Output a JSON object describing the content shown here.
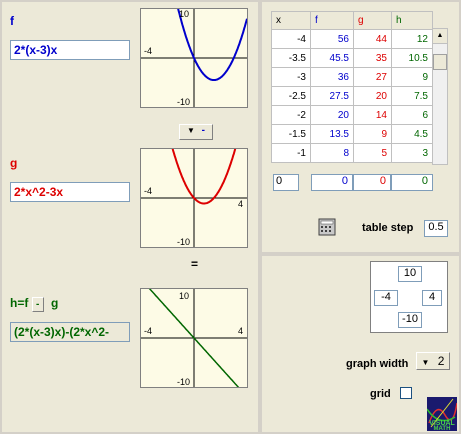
{
  "f": {
    "label": "f",
    "expr": "2*(x-3)x",
    "color": "#0000cc",
    "graph": {
      "ymax": "10",
      "xmin": "-4",
      "ymin": "-10"
    }
  },
  "op": {
    "symbol": "-"
  },
  "g": {
    "label": "g",
    "expr": "2*x^2-3x",
    "color": "#dd0000",
    "graph": {
      "xmin": "-4",
      "xmax": "4",
      "ymin": "-10"
    }
  },
  "equals": "=",
  "h": {
    "label_prefix": "h=f",
    "op": "-",
    "label_suffix": "g",
    "expr": "(2*(x-3)x)-(2*x^2-",
    "color": "#006600",
    "graph": {
      "ymax": "10",
      "xmin": "-4",
      "xmax": "4",
      "ymin": "-10"
    }
  },
  "table": {
    "headers": [
      "x",
      "f",
      "g",
      "h"
    ],
    "rows": [
      [
        "-4",
        "56",
        "44",
        "12"
      ],
      [
        "-3.5",
        "45.5",
        "35",
        "10.5"
      ],
      [
        "-3",
        "36",
        "27",
        "9"
      ],
      [
        "-2.5",
        "27.5",
        "20",
        "7.5"
      ],
      [
        "-2",
        "20",
        "14",
        "6"
      ],
      [
        "-1.5",
        "13.5",
        "9",
        "4.5"
      ],
      [
        "-1",
        "8",
        "5",
        "3"
      ]
    ],
    "input_row": [
      "0",
      "0",
      "0",
      "0"
    ]
  },
  "table_step": {
    "label": "table step",
    "value": "0.5"
  },
  "window": {
    "ymax": "10",
    "xmin": "-4",
    "xmax": "4",
    "ymin": "-10"
  },
  "graph_width": {
    "label": "graph width",
    "value": "2"
  },
  "grid": {
    "label": "grid",
    "checked": false
  },
  "logo": {
    "text": "VISUAL MATH"
  }
}
